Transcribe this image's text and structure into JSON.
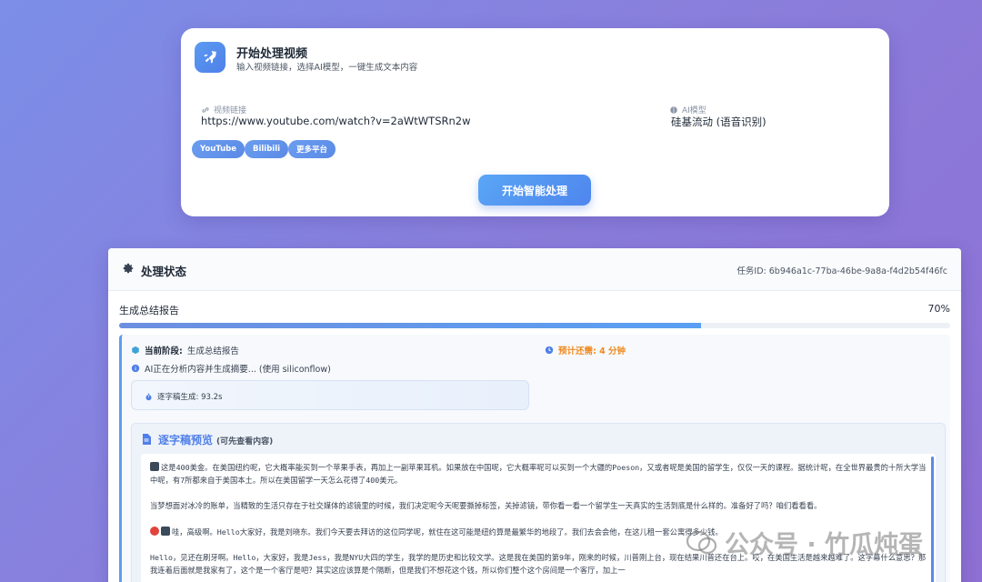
{
  "top_card": {
    "title": "开始处理视频",
    "subtitle": "输入视频链接，选择AI模型，一键生成文本内容",
    "url_label": "视频链接",
    "url_value": "https://www.youtube.com/watch?v=2aWtWTSRn2w",
    "model_label": "AI模型",
    "model_value": "硅基流动 (语音识别)",
    "platforms": [
      "YouTube",
      "Bilibili",
      "更多平台"
    ],
    "start_button": "开始智能处理"
  },
  "status": {
    "title": "处理状态",
    "task_id": "任务ID: 6b946a1c-77ba-46be-9a8a-f4d2b54f46fc",
    "stage_text": "生成总结报告",
    "percent_text": "70%",
    "progress": 0.7,
    "current_stage_label": "当前阶段:",
    "current_stage_value": "生成总结报告",
    "eta": "预计还需: 4 分钟",
    "ai_note": "AI正在分析内容并生成摘要... (使用 siliconflow)",
    "transcript_time": "逐字稿生成: 93.2s"
  },
  "preview": {
    "title": "逐字稿预览",
    "hint": "(可先查看内容)",
    "paragraphs": [
      "这是400美金。在美国纽约呢，它大概率能买到一个苹果手表，再加上一副苹果耳机。如果放在中国呢，它大概率呢可以买到一个大疆的Poeson，又或者呢是美国的留学生，仅仅一天的课程。据统计呢，在全世界最贵的十所大学当中呢，有7所都来自于美国本土。所以在美国留学一天怎么花得了400美元。",
      "当梦想面对冰冷的账单，当精致的生活只存在于社交媒体的滤镜里的时候，我们决定呢今天呢要撕掉标签，关掉滤镜，带你看一看一个留学生一天真实的生活到底是什么样的。准备好了吗？咱们看看看。",
      "哇，高级啊。Hello大家好，我是刘晓东。我们今天要去拜访的这位同学呢，就住在这可能是纽约算是最繁华的地段了。我们去会会他，在这儿租一套公寓得多少钱。",
      "Hello，见还在刷牙啊。Hello，大家好，我是Jess，我是NYU大四的学生，我学的是历史和比较文学。这是我在美国的第9年，刚来的时候，川普刚上台，现在结果川普还在台上。哎，在美国生活是越来越难了。这字幕什么意思？那我连着后面就是我家有了，这个是一个客厅是吧？其实这应该算是个隔断，但是我们不想花这个钱，所以你们整个这个房间是一个客厅，加上一"
    ]
  },
  "watermark": {
    "text": "公众号 · 竹瓜炖蛋"
  },
  "colors": {
    "accent": "#4f7fe8",
    "eta": "#f08a1f"
  }
}
